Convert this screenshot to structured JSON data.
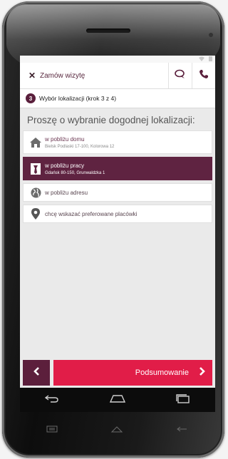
{
  "app": {
    "title": "Zamów wizytę"
  },
  "step": {
    "number": "3",
    "label": "Wybór lokalizacji (krok 3 z 4)"
  },
  "heading": "Proszę o wybranie dogodnej lokalizacji:",
  "options": [
    {
      "title": "w pobliżu domu",
      "subtitle": "Bielsk Podlaski 17-100, Kolorowa 12",
      "icon": "home-icon",
      "selected": false
    },
    {
      "title": "w pobliżu pracy",
      "subtitle": "Gdańsk 80-150, Grunwaldzka 1",
      "icon": "briefcase-icon",
      "selected": true
    },
    {
      "title": "w pobliżu adresu",
      "icon": "globe-icon",
      "selected": false
    },
    {
      "title": "chcę wskazać preferowane placówki",
      "icon": "map-pin-icon",
      "selected": false
    }
  ],
  "footer": {
    "back_icon": "chevron-left-icon",
    "summary_label": "Podsumowanie",
    "summary_icon": "chevron-right-icon"
  },
  "colors": {
    "brand_dark": "#5f2341",
    "accent_red": "#e11d48"
  }
}
